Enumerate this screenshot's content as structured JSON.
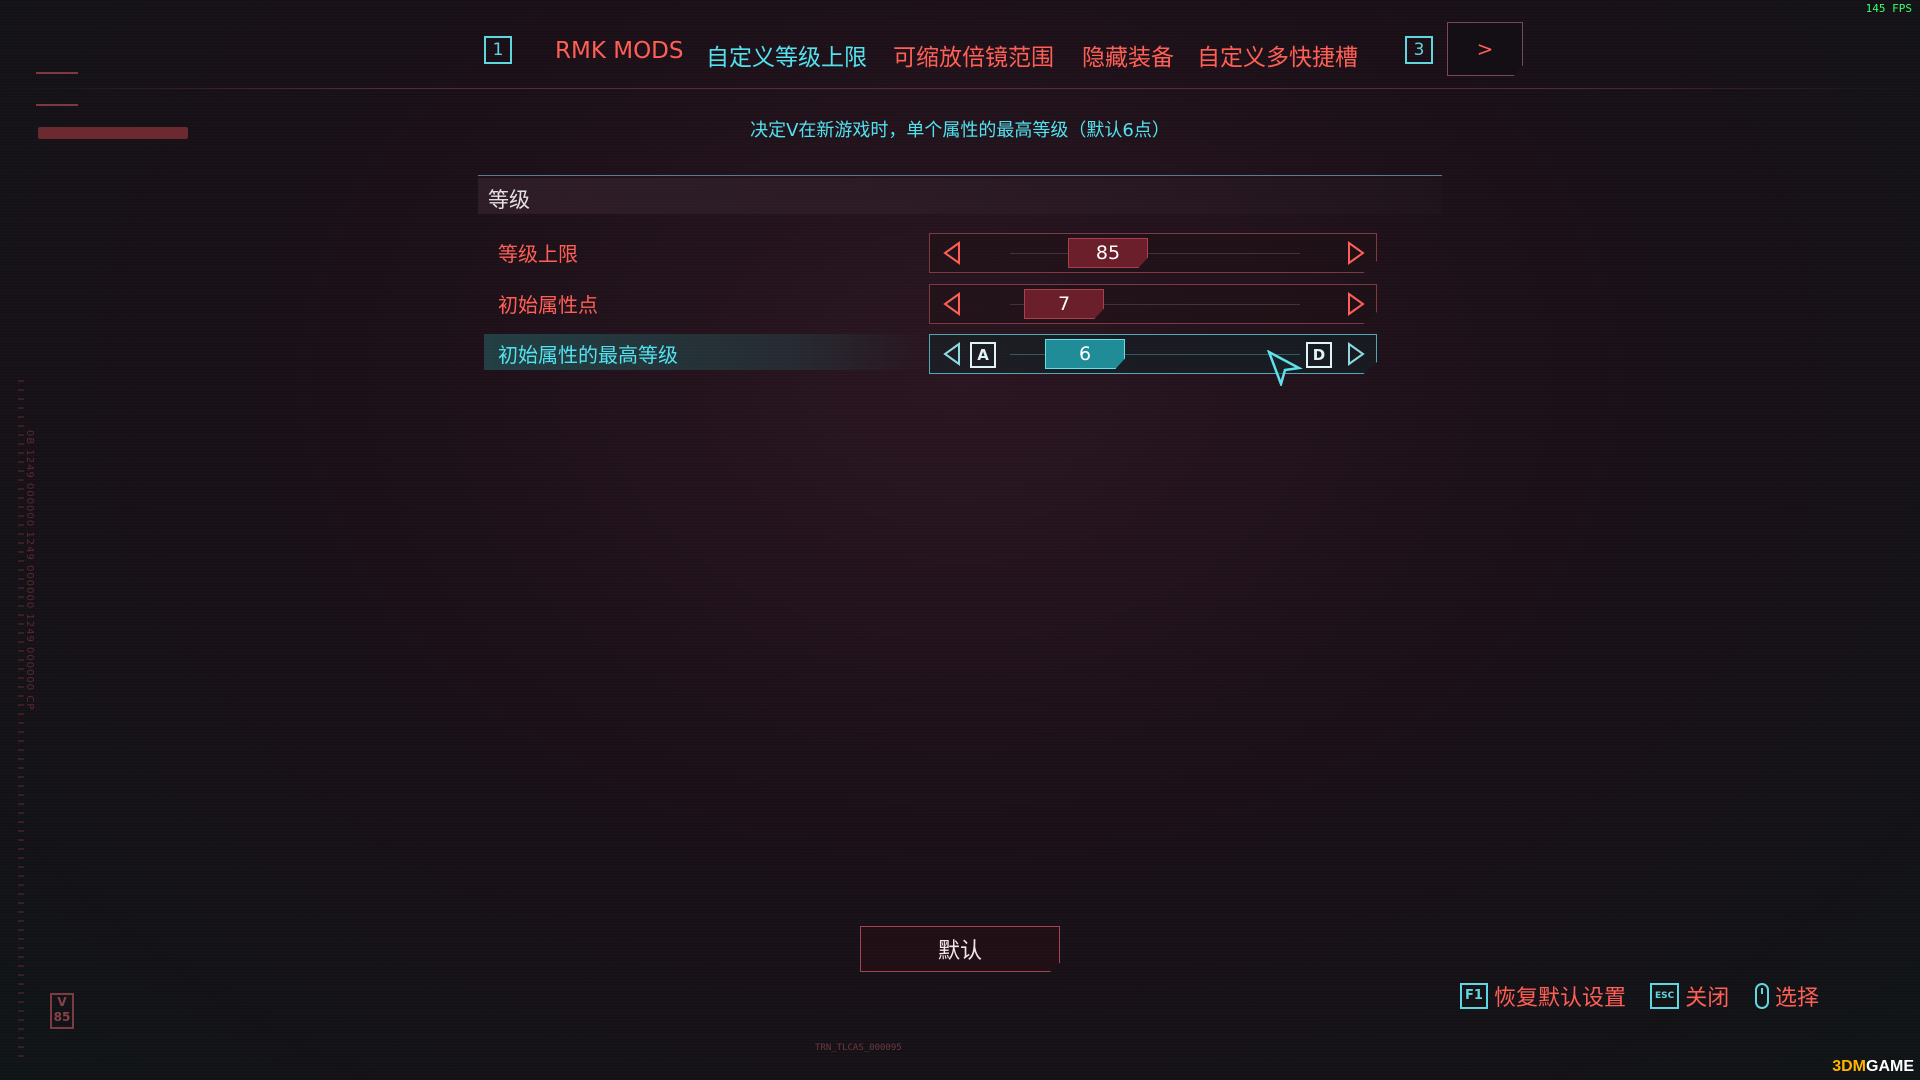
{
  "fps": "145 FPS",
  "tabs": {
    "left_key": "1",
    "right_key": "3",
    "items": [
      "RMK MODS",
      "自定义等级上限",
      "可缩放倍镜范围",
      "隐藏装备",
      "自定义多快捷槽"
    ],
    "next_label": ">"
  },
  "description": "决定V在新游戏时，单个属性的最高等级（默认6点）",
  "section": {
    "title": "等级"
  },
  "rows": [
    {
      "label": "等级上限",
      "value": "85"
    },
    {
      "label": "初始属性点",
      "value": "7"
    },
    {
      "label": "初始属性的最高等级",
      "value": "6",
      "key_left": "A",
      "key_right": "D"
    }
  ],
  "default_button": "默认",
  "hints": {
    "restore_key": "F1",
    "restore_label": "恢复默认设置",
    "close_key": "ESC",
    "close_label": "关闭",
    "select_label": "选择"
  },
  "hud": {
    "bar_text": "TRN_TLCAS_000095",
    "side_text": "0B 1249 000000 1249 000000 1249 000000 CP",
    "badge": "V 85"
  },
  "watermark": {
    "prefix": "3DM",
    "suffix": "GAME"
  },
  "colors": {
    "accent_red": "#ff5f55",
    "accent_cyan": "#52e2ef",
    "thumb_red": "#6b1f2a",
    "thumb_cyan": "#1f8c98"
  }
}
